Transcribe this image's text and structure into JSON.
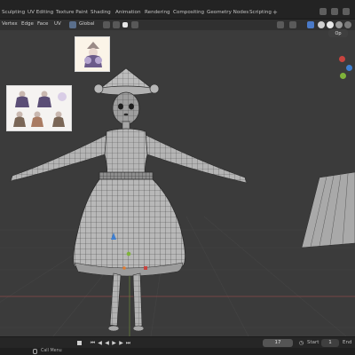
{
  "workspace_tabs": [
    "Sculpting",
    "UV Editing",
    "Texture Paint",
    "Shading",
    "Animation",
    "Rendering",
    "Compositing",
    "Geometry Nodes",
    "Scripting"
  ],
  "add_tab_symbol": "+",
  "header": {
    "select_modes": [
      "Vertex",
      "Edge",
      "Face"
    ],
    "uv_menu": "UV",
    "orientation": "Global",
    "overlay_label": "Op"
  },
  "timeline": {
    "current_frame": "17",
    "start_label": "Start",
    "start_value": "1",
    "end_label": "End"
  },
  "status_bar": {
    "left_action": "Call Menu"
  },
  "colors": {
    "viewport_bg": "#3b3b3b",
    "mesh_fill": "#b4b4b4",
    "wire": "#2a2a2a",
    "gizmo_x": "#c8443f",
    "gizmo_y": "#7fb33a",
    "gizmo_z": "#3f7fd0"
  }
}
